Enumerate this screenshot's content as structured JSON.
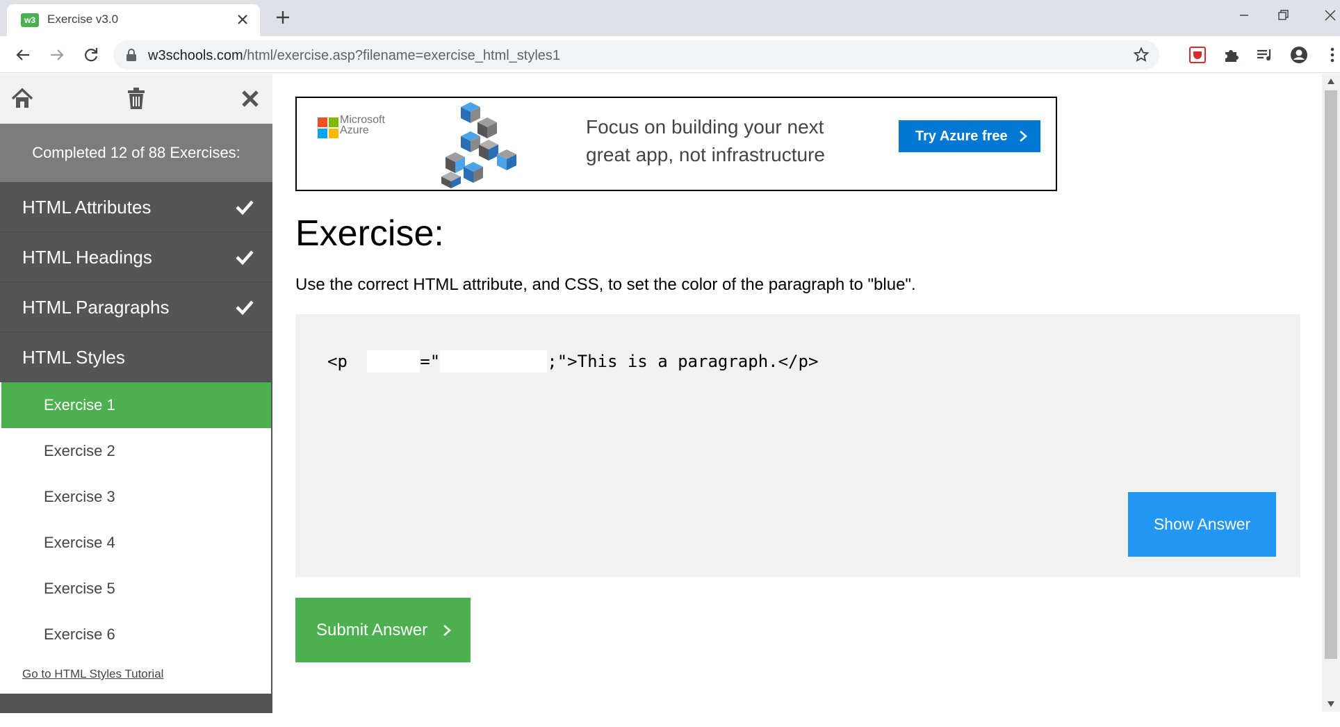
{
  "browser": {
    "tab_title": "Exercise v3.0",
    "favicon_text": "w3",
    "url_host": "w3schools.com",
    "url_path": "/html/exercise.asp?filename=exercise_html_styles1"
  },
  "sidebar": {
    "progress_text": "Completed 12 of 88 Exercises:",
    "chapters": [
      {
        "label": "HTML Attributes",
        "completed": true
      },
      {
        "label": "HTML Headings",
        "completed": true
      },
      {
        "label": "HTML Paragraphs",
        "completed": true
      },
      {
        "label": "HTML Styles",
        "completed": false
      }
    ],
    "exercises": [
      {
        "label": "Exercise 1",
        "active": true
      },
      {
        "label": "Exercise 2",
        "active": false
      },
      {
        "label": "Exercise 3",
        "active": false
      },
      {
        "label": "Exercise 4",
        "active": false
      },
      {
        "label": "Exercise 5",
        "active": false
      },
      {
        "label": "Exercise 6",
        "active": false
      }
    ],
    "tutorial_link": "Go to HTML Styles Tutorial"
  },
  "ad": {
    "brand_line1": "Microsoft",
    "brand_line2": "Azure",
    "headline_line1": "Focus on building your next",
    "headline_line2": "great app, not infrastructure",
    "cta": "Try Azure free"
  },
  "exercise": {
    "heading": "Exercise:",
    "instruction": "Use the correct HTML attribute, and CSS, to set the color of the paragraph to \"blue\".",
    "code_part1": "<p ",
    "code_part2": "=\"",
    "code_part3": ";\">This is a paragraph.</p>",
    "input1_value": "",
    "input2_value": "",
    "show_answer": "Show Answer",
    "submit": "Submit Answer"
  },
  "colors": {
    "green": "#4caf50",
    "blue": "#2196f3",
    "sidebar_dark": "#555555",
    "azure": "#0078d4"
  }
}
